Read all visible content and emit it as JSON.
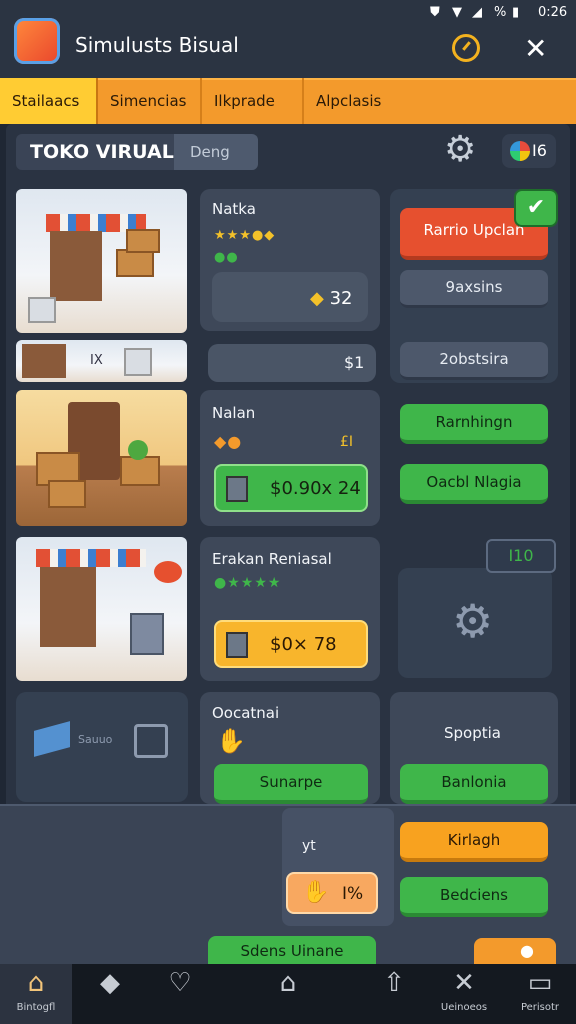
{
  "status_bar": {
    "battery": "%",
    "time": "0:26"
  },
  "app": {
    "title": "Simulusts Bisual"
  },
  "tabs": [
    {
      "label": "Stailaacs"
    },
    {
      "label": "Simencias"
    },
    {
      "label": "Ilkprade"
    },
    {
      "label": "Alpclasis"
    }
  ],
  "shop": {
    "title": "TOKO VIRUAL",
    "subtitle": "Deng",
    "badge_count": "I6"
  },
  "row1": {
    "item_name": "Natka",
    "price": "32",
    "mini_label": "IX",
    "mini_price": "$1",
    "btn_primary": "Rarrio Upclan",
    "btn_secondary": "9axsins",
    "btn_tertiary": "2obstsira"
  },
  "row2": {
    "item_name": "Nalan",
    "sub_label": "£I",
    "price": "$0.90x 24",
    "btn_primary": "Rarnhingn",
    "btn_secondary": "Oacbl Nlagia"
  },
  "row3": {
    "item_name": "Erakan Reniasal",
    "price": "$0× 78",
    "corner_badge": "I10"
  },
  "row4": {
    "left_label": "Sauuo",
    "item_name": "Oocatnai",
    "btn_green": "Sunarpe",
    "right_title": "Spoptia",
    "right_btn": "Banlonia"
  },
  "row5": {
    "label": "yt",
    "discount": "I%",
    "btn_orange": "Kirlagh",
    "btn_green": "Bedciens"
  },
  "row6": {
    "btn_green": "Sdens Uinane"
  },
  "bottom_nav": [
    {
      "label": "Bintogfl",
      "icon": "home-icon"
    },
    {
      "label": "",
      "icon": "tag-icon"
    },
    {
      "label": "",
      "icon": "heart-icon"
    },
    {
      "label": "",
      "icon": "house-icon"
    },
    {
      "label": "",
      "icon": "export-icon"
    },
    {
      "label": "Ueinoeos",
      "icon": "tools-icon"
    },
    {
      "label": "Perisotr",
      "icon": "wallet-icon"
    }
  ],
  "colors": {
    "accent": "#f39a2c",
    "tab_active": "#ffcc33",
    "green": "#3fb64a",
    "red": "#e6502f",
    "orange": "#f8a21f"
  }
}
